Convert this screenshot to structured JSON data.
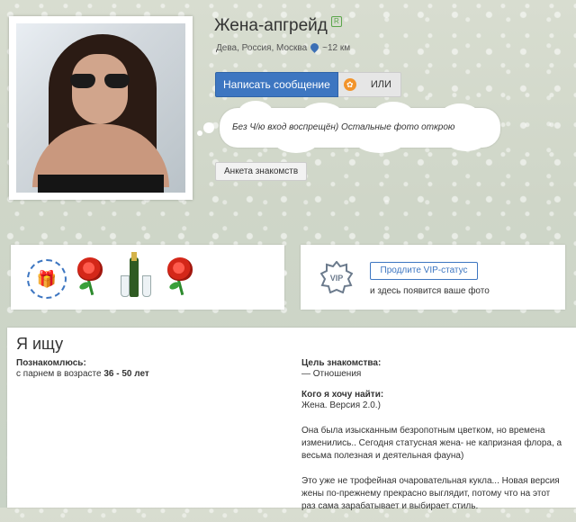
{
  "profile": {
    "name": "Жена-апгрейд",
    "badge": "R",
    "meta_prefix": "Дева, Россия, Москва",
    "distance": "~12 км"
  },
  "actions": {
    "message_label": "Написать сообщение",
    "or_label": "ИЛИ"
  },
  "status_text": "Без Ч/ю вход воспрещён) Остальные фото открою",
  "profile_link": "Анкета знакомств",
  "vip": {
    "button_label": "Продлите VIP-статус",
    "note": "и здесь появится ваше фото"
  },
  "seek": {
    "title": "Я ищу",
    "meet_label": "Познакомлюсь:",
    "meet_prefix": "с парнем в возрасте",
    "age_from": "36",
    "age_sep": " - ",
    "age_to": "50 лет",
    "goal_label": "Цель знакомства:",
    "goal_value": "— Отношения",
    "who_label": "Кого я хочу найти:",
    "who_p1": "Жена. Версия 2.0.)",
    "who_p2": "Она была изысканным безропотным цветком, но времена изменились.. Сегодня статусная жена- не капризная флора, а весьма полезная и деятельная фауна)",
    "who_p3": "Это уже не трофейная очаровательная кукла... Новая версия жены по-прежнему прекрасно выглядит, потому что на этот раз сама зарабатывает и выбирает стиль."
  },
  "colors": {
    "accent": "#3d76c1",
    "badge_green": "#5aa54a",
    "rose_red": "#d42719"
  },
  "icons": [
    "location-pin-icon",
    "gift-icon",
    "rose-icon",
    "champagne-icon",
    "vip-icon"
  ]
}
